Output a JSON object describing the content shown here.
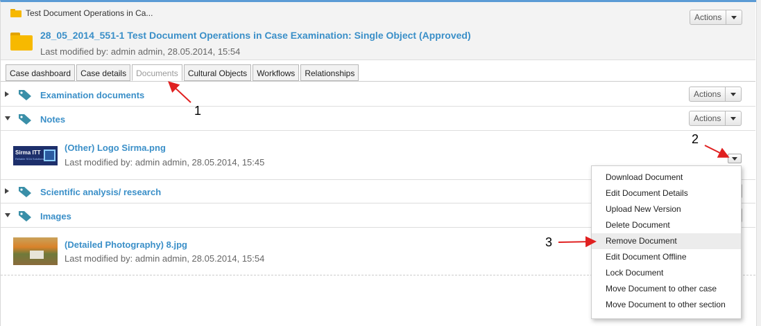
{
  "header": {
    "breadcrumb": "Test Document Operations in Ca...",
    "case_title": "28_05_2014_551-1 Test Document Operations in Case Examination: Single Object (Approved)",
    "last_modified": "Last modified by: admin admin, 28.05.2014, 15:54",
    "actions_label": "Actions"
  },
  "tabs": [
    "Case dashboard",
    "Case details",
    "Documents",
    "Cultural Objects",
    "Workflows",
    "Relationships"
  ],
  "active_tab": "Documents",
  "sections": [
    {
      "name": "Examination documents",
      "expanded": false,
      "actions_label": "Actions"
    },
    {
      "name": "Notes",
      "expanded": true,
      "actions_label": "Actions"
    },
    {
      "name": "Scientific analysis/ research",
      "expanded": false
    },
    {
      "name": "Images",
      "expanded": true
    }
  ],
  "documents": [
    {
      "title": "(Other) Logo Sirma.png",
      "modified": "Last modified by: admin admin, 28.05.2014, 15:45",
      "thumb_text": "Sirma ITT",
      "thumb_sub": "Reliable SOA Solutions"
    },
    {
      "title": "(Detailed Photography) 8.jpg",
      "modified": "Last modified by: admin admin, 28.05.2014, 15:54"
    }
  ],
  "dropdown_menu": {
    "items": [
      "Download Document",
      "Edit Document Details",
      "Upload New Version",
      "Delete Document",
      "Remove Document",
      "Edit Document Offline",
      "Lock Document",
      "Move Document to other case",
      "Move Document to other section"
    ],
    "highlighted": "Remove Document"
  },
  "annotations": [
    "1",
    "2",
    "3"
  ],
  "colors": {
    "link": "#3a8fc8",
    "folder": "#f6b800",
    "tag": "#3a8fa8",
    "annotation_arrow": "#e02020"
  }
}
